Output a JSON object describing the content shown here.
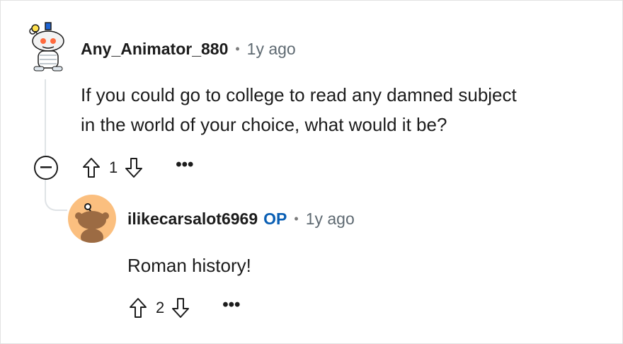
{
  "comment": {
    "username": "Any_Animator_880",
    "separator": "•",
    "time": "1y ago",
    "body_line1": "If you could go to college to read any damned subject",
    "body_line2": "in the world of your choice, what would it be?",
    "score": "1",
    "more": "•••",
    "avatar_icon": "snoo-robot-avatar-icon"
  },
  "reply": {
    "username": "ilikecarsalot6969",
    "op_badge": "OP",
    "separator": "•",
    "time": "1y ago",
    "body": "Roman history!",
    "score": "2",
    "more": "•••",
    "avatar_icon": "snoo-default-avatar-icon"
  },
  "colors": {
    "op": "#0a5fb4",
    "avatar_bg": "#fbbf7f",
    "thread_line": "#dfe3e6"
  }
}
